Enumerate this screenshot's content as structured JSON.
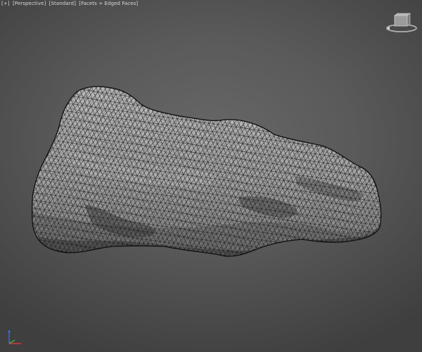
{
  "viewport": {
    "label_parts": [
      "[+]",
      "[Perspective]",
      "[Standard]",
      "[Facets + Edged Faces]"
    ],
    "background_color": "#5d5d5d",
    "mesh_face_color": "#9d9d9d",
    "mesh_edge_color": "#1e1e1e"
  },
  "icons": {
    "viewcube": "viewcube-icon",
    "axis": "axis-tripod-icon"
  },
  "axis_colors": {
    "x": "#d23a3a",
    "y": "#3ab34a",
    "z": "#3a6fd2"
  }
}
